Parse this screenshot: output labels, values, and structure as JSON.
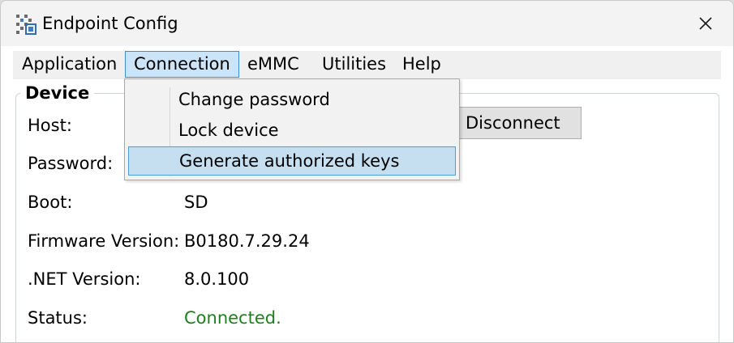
{
  "window": {
    "title": "Endpoint Config",
    "icon": "app-grid-icon",
    "close_icon": "close-icon"
  },
  "menu": {
    "items": [
      {
        "label": "Application"
      },
      {
        "label": "Connection",
        "active": true
      },
      {
        "label": "eMMC"
      },
      {
        "label": "Utilities"
      },
      {
        "label": "Help"
      }
    ]
  },
  "connection_menu": {
    "items": [
      {
        "label": "Change password"
      },
      {
        "label": "Lock device"
      },
      {
        "label": "Generate authorized keys",
        "highlighted": true
      }
    ]
  },
  "device": {
    "group_title": "Device",
    "host_label": "Host:",
    "password_label": "Password:",
    "boot_label": "Boot:",
    "boot_value": "SD",
    "firmware_label": "Firmware Version:",
    "firmware_value": "B0180.7.29.24",
    "dotnet_label": ".NET Version:",
    "dotnet_value": "8.0.100",
    "status_label": "Status:",
    "status_value": "Connected.",
    "disconnect_label": "Disconnect"
  },
  "colors": {
    "status_ok": "#1e7f1e",
    "menu_active_bg": "#cce4f7",
    "menu_active_border": "#3a90d4"
  }
}
